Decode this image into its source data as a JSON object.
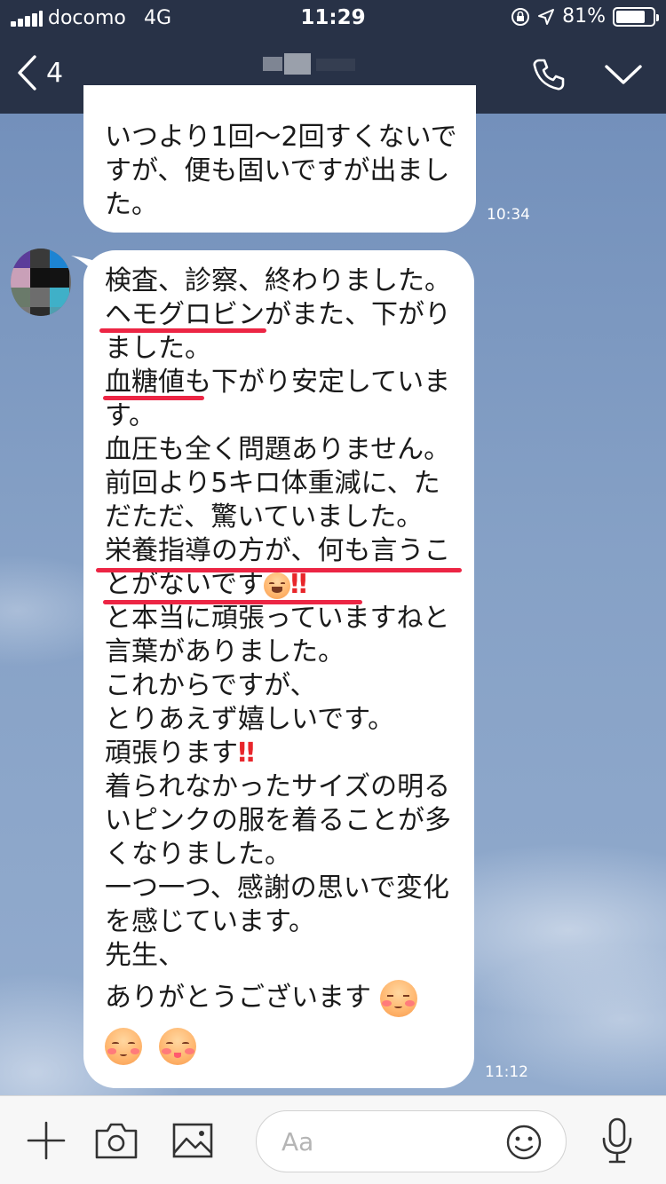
{
  "status_bar": {
    "carrier": "docomo",
    "network": "4G",
    "time": "11:29",
    "battery_percent": "81%",
    "battery_level": 0.81
  },
  "header": {
    "back_count": "4",
    "chat_title": "",
    "page_indicator": {
      "count": 3,
      "active_index": 0
    },
    "call_icon": "phone-icon",
    "menu_icon": "chevron-down-icon"
  },
  "messages": [
    {
      "lines": [
        "いつより1回〜2回すくないで",
        "すが、便も固いですが出まし",
        "た。"
      ],
      "time": "10:34"
    },
    {
      "lines": [
        "検査、診察、終わりました。",
        "ヘモグロビンがまた、下がり",
        "ました。",
        "血糖値も下がり安定していま",
        "す。",
        "血圧も全く問題ありません。",
        "前回より5キロ体重減に、た",
        "だただ、驚いていました。",
        "栄養指導の方が、何も言うこ",
        "とがないです",
        "と本当に頑張っていますねと",
        "言葉がありました。",
        "これからですが、",
        "とりあえず嬉しいです。",
        "頑張ります",
        "着られなかったサイズの明る",
        "いピンクの服を着ることが多",
        "くなりました。",
        "一つ一つ、感謝の思いで変化",
        "を感じています。",
        "先生、",
        "ありがとうございます"
      ],
      "exclaim": "‼",
      "emoji_names": [
        "laughing-tears-emoji",
        "blushing-face-emoji",
        "smiling-face-emoji",
        "yummy-face-emoji"
      ],
      "time": "11:12"
    }
  ],
  "composer": {
    "placeholder": "Aa",
    "icons": [
      "plus-icon",
      "camera-icon",
      "image-icon",
      "emoji-icon",
      "microphone-icon"
    ]
  },
  "colors": {
    "header_bg": "#283247",
    "underline": "#ec2544",
    "bubble": "#ffffff"
  }
}
